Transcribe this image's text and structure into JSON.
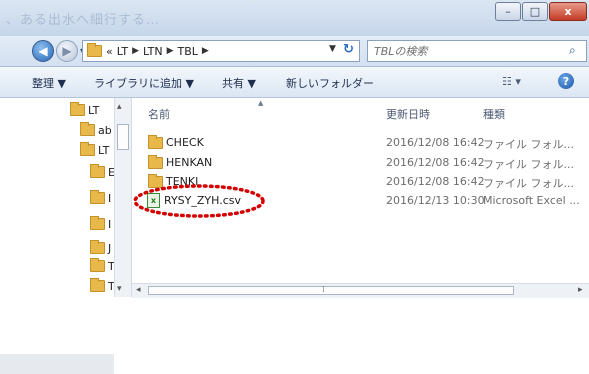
{
  "window": {
    "faded_title": "、ある出水へ細行する…",
    "minimize": "–",
    "maximize": "□",
    "close": "x"
  },
  "address": {
    "overflow": "«",
    "crumbs": [
      "LT",
      "LTN",
      "TBL"
    ],
    "refresh": "↻"
  },
  "search": {
    "placeholder": "TBLの検索"
  },
  "toolbar": {
    "organize": "整理 ▼",
    "include_library": "ライブラリに追加 ▼",
    "share": "共有 ▼",
    "new_folder": "新しいフォルダー",
    "view": "☷ ▾",
    "help": "?"
  },
  "tree": [
    {
      "label": "LT"
    },
    {
      "label": "ab"
    },
    {
      "label": "LT"
    },
    {
      "label": "E"
    },
    {
      "label": "I"
    },
    {
      "label": "I"
    },
    {
      "label": "J"
    },
    {
      "label": "T"
    },
    {
      "label": "T"
    }
  ],
  "columns": {
    "name": "名前",
    "modified": "更新日時",
    "type": "種類"
  },
  "files": [
    {
      "name": "CHECK",
      "modified": "2016/12/08 16:42",
      "type": "ファイル フォル..."
    },
    {
      "name": "HENKAN",
      "modified": "2016/12/08 16:42",
      "type": "ファイル フォル..."
    },
    {
      "name": "TENKI",
      "modified": "2016/12/08 16:42",
      "type": "ファイル フォル..."
    },
    {
      "name": "RYSY_ZYH.csv",
      "modified": "2016/12/13 10:30",
      "type": "Microsoft Excel ..."
    }
  ],
  "scroll": {
    "left": "◂",
    "grip": "⁞",
    "right": "▸",
    "up": "▴",
    "down": "▾"
  },
  "colors": {
    "highlight_ring": "#d40000",
    "selected_row": "#e9eef5"
  }
}
